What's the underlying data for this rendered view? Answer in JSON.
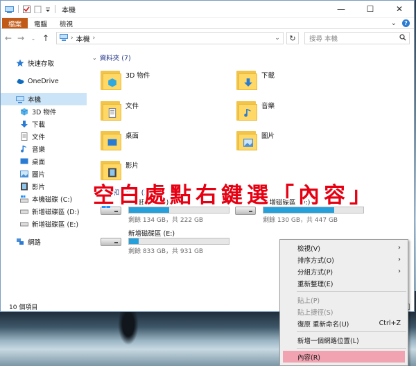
{
  "window": {
    "title": "本機",
    "controls": {
      "minimize": "—",
      "maximize": "☐",
      "close": "✕"
    }
  },
  "ribbon": {
    "tabs": [
      "檔案",
      "電腦",
      "檢視"
    ],
    "expand": "⌄",
    "help": "?"
  },
  "address": {
    "path": "本機",
    "search_placeholder": "搜尋 本機"
  },
  "nav": {
    "quick_access": "快速存取",
    "onedrive": "OneDrive",
    "this_pc": "本機",
    "children": [
      "3D 物件",
      "下載",
      "文件",
      "音樂",
      "桌面",
      "圖片",
      "影片",
      "本機磁碟 (C:)",
      "新增磁碟區 (D:)",
      "新增磁碟區 (E:)"
    ],
    "network": "網路"
  },
  "folders": {
    "header": "資料夾 (7)",
    "items": [
      "3D 物件",
      "下載",
      "文件",
      "音樂",
      "桌面",
      "圖片",
      "影片"
    ]
  },
  "drives": {
    "header": "裝置和磁碟機 (3)",
    "items": [
      {
        "name": "本機磁碟 (C:)",
        "free": "剩餘 134 GB，共 222 GB",
        "used_fraction": 0.4
      },
      {
        "name": "新增磁碟區 (D:)",
        "free": "剩餘 130 GB，共 447 GB",
        "used_fraction": 0.71
      },
      {
        "name": "新增磁碟區 (E:)",
        "free": "剩餘 833 GB，共 931 GB",
        "used_fraction": 0.1
      }
    ]
  },
  "status": {
    "count": "10 個項目"
  },
  "overlay": {
    "text": "空白處點右鍵選「內容」"
  },
  "context_menu": {
    "items": [
      {
        "label": "檢視(V)",
        "arrow": "›"
      },
      {
        "label": "排序方式(O)",
        "arrow": "›"
      },
      {
        "label": "分組方式(P)",
        "arrow": "›"
      },
      {
        "label": "重新整理(E)"
      },
      {
        "label": "貼上(P)"
      },
      {
        "label": "貼上捷徑(S)"
      },
      {
        "label": "復原 重新命名(U)",
        "accel": "Ctrl+Z"
      },
      {
        "label": "新增一個網路位置(L)"
      },
      {
        "label": "內容(R)"
      }
    ]
  },
  "colors": {
    "accent": "#c05a16",
    "selection": "#cce4f7",
    "folder_header": "#1e3287",
    "drive_bar": "#26a0da",
    "overlay_text": "#e60012",
    "menu_highlight": "#f1a3b1"
  }
}
